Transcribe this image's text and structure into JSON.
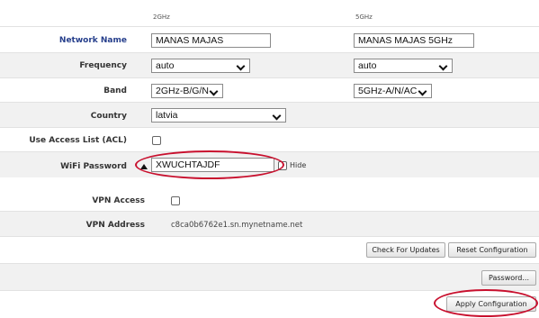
{
  "wifi": {
    "col_2ghz": "2GHz",
    "col_5ghz": "5GHz",
    "network_name_label": "Network Name",
    "network_name_2ghz": "MANAS MAJAS",
    "network_name_5ghz": "MANAS MAJAS 5GHz",
    "frequency_label": "Frequency",
    "frequency_2ghz": "auto",
    "frequency_5ghz": "auto",
    "band_label": "Band",
    "band_2ghz": "2GHz-B/G/N",
    "band_5ghz": "5GHz-A/N/AC",
    "country_label": "Country",
    "country_value": "latvia",
    "acl_label": "Use Access List (ACL)",
    "acl_checked": false,
    "password_label": "WiFi Password",
    "password_value": "XWUCHTAJDF",
    "hide_label": "Hide",
    "hide_checked": false
  },
  "vpn": {
    "access_label": "VPN Access",
    "access_checked": false,
    "address_label": "VPN Address",
    "address_value": "c8ca0b6762e1.sn.mynetname.net"
  },
  "buttons": {
    "check_updates": "Check For Updates",
    "reset_config": "Reset Configuration",
    "password": "Password...",
    "apply_config": "Apply Configuration"
  },
  "colors": {
    "highlight": "#c8102e",
    "network_name_label": "#263f8c"
  },
  "icons": {
    "expand": "triangle-up-icon"
  }
}
